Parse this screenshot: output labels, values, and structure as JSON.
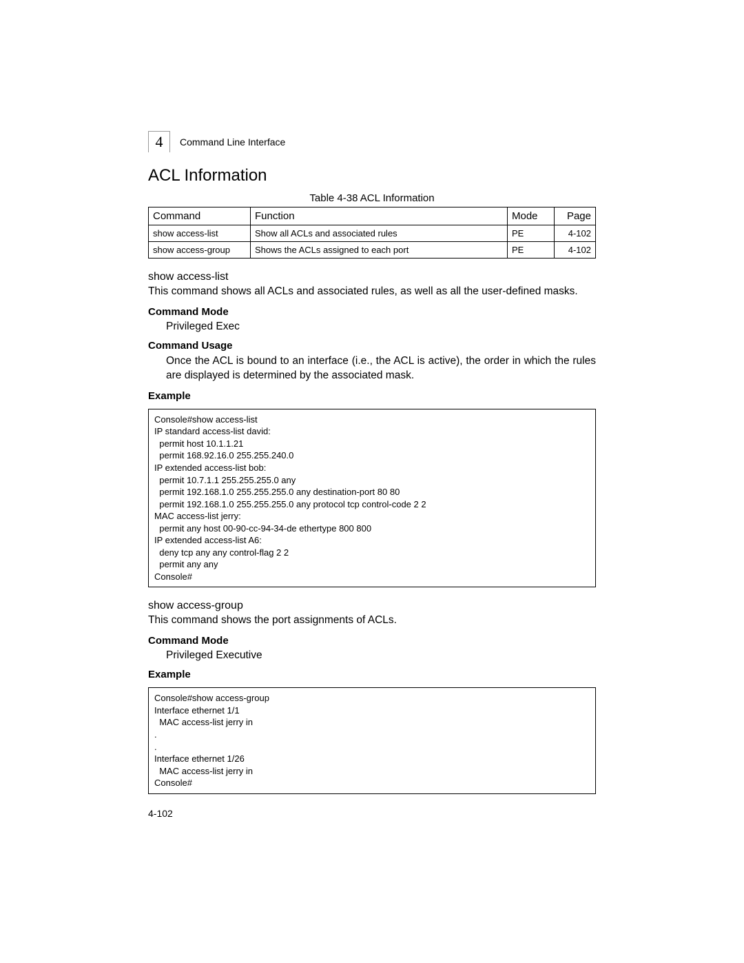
{
  "header": {
    "chapter_number": "4",
    "chapter_title": "Command Line Interface"
  },
  "section_title": "ACL Information",
  "table": {
    "caption": "Table 4-38  ACL Information",
    "headers": {
      "command": "Command",
      "function": "Function",
      "mode": "Mode",
      "page": "Page"
    },
    "rows": [
      {
        "command": "show access-list",
        "function": "Show all ACLs and associated rules",
        "mode": "PE",
        "page": "4-102"
      },
      {
        "command": "show access-group",
        "function": "Shows the ACLs assigned to each port",
        "mode": "PE",
        "page": "4-102"
      }
    ]
  },
  "cmd1": {
    "name": "show access-list",
    "description": "This command shows all ACLs and associated rules, as well as all the user-defined masks.",
    "mode_label": "Command Mode",
    "mode_value": "Privileged Exec",
    "usage_label": "Command Usage",
    "usage_text": "Once the ACL is bound to an interface (i.e., the ACL is active), the order in which the rules are displayed is determined by the associated mask.",
    "example_label": "Example",
    "example_code": "Console#show access-list\nIP standard access-list david:\n  permit host 10.1.1.21\n  permit 168.92.16.0 255.255.240.0\nIP extended access-list bob:\n  permit 10.7.1.1 255.255.255.0 any\n  permit 192.168.1.0 255.255.255.0 any destination-port 80 80\n  permit 192.168.1.0 255.255.255.0 any protocol tcp control-code 2 2\nMAC access-list jerry:\n  permit any host 00-90-cc-94-34-de ethertype 800 800\nIP extended access-list A6:\n  deny tcp any any control-flag 2 2\n  permit any any\nConsole#"
  },
  "cmd2": {
    "name": "show access-group",
    "description": "This command shows the port assignments of ACLs.",
    "mode_label": "Command Mode",
    "mode_value": "Privileged Executive",
    "example_label": "Example",
    "example_code": "Console#show access-group\nInterface ethernet 1/1\n  MAC access-list jerry in\n.\n.\nInterface ethernet 1/26\n  MAC access-list jerry in\nConsole#"
  },
  "page_number": "4-102"
}
